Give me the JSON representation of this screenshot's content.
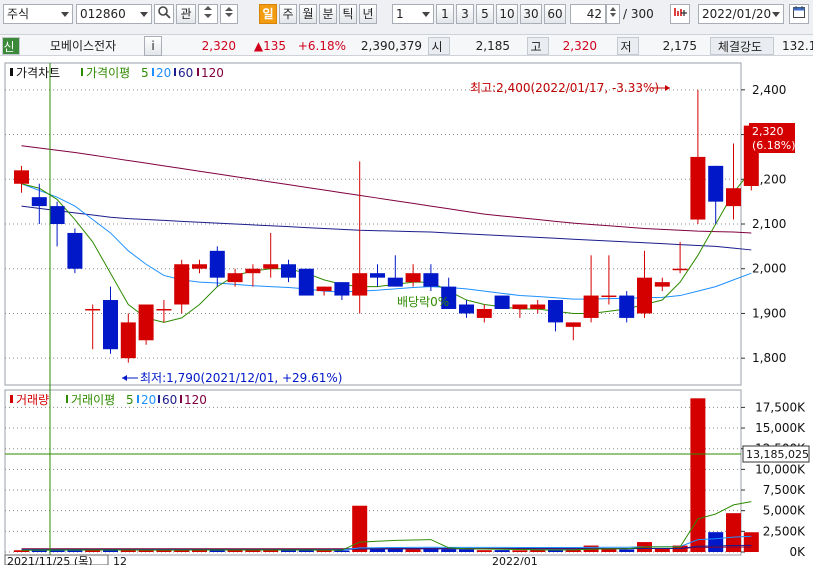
{
  "toolbar": {
    "market_type": "주식",
    "stock_code": "012860",
    "btn_kwan": "관",
    "periods": [
      "일",
      "주",
      "월",
      "분",
      "틱",
      "년"
    ],
    "active_period": "일",
    "minute_select": "1",
    "minute_presets": [
      "1",
      "3",
      "5",
      "10",
      "30",
      "60"
    ],
    "count_value": "42",
    "count_total": "/ 300",
    "date": "2022/01/20"
  },
  "quote": {
    "badge": "신",
    "name": "모베이스전자",
    "info_btn": "i",
    "price": "2,320",
    "change": "▲135",
    "change_rate": "+6.18%",
    "volume": "2,390,379",
    "open_label": "시",
    "open": "2,185",
    "high_label": "고",
    "high": "2,320",
    "low_label": "저",
    "low": "2,175",
    "strength_label": "체결강도",
    "strength": "132.1"
  },
  "price_legend": {
    "title": "가격차트",
    "ma_label": "가격이평",
    "ma_periods": [
      "5",
      "20",
      "60",
      "120"
    ]
  },
  "volume_legend": {
    "title": "거래량",
    "ma_label": "거래이평",
    "ma_periods": [
      "5",
      "20",
      "60",
      "120"
    ]
  },
  "annotations": {
    "high": "최고:2,400(2022/01/17, -3.33%)",
    "low": "최저:1,790(2021/12/01, +29.61%)",
    "ex_dividend": "배당락0%",
    "last_price": "2,320",
    "last_rate": "(6.18%)",
    "volume_cursor": "13,185,025",
    "date_cursor": "2021/11/25 (목)",
    "date_12": "12",
    "date_2022": "2022/01"
  },
  "colors": {
    "up": "#d40000",
    "down": "#0018c8",
    "ma5": "#2e8b00",
    "ma20": "#1e90ff",
    "ma60": "#1c1c8c",
    "ma120": "#800040",
    "grid": "#8a8a8a",
    "cursor": "#2e8b00"
  },
  "chart_data": {
    "type": "candlestick",
    "ylim": [
      1740,
      2460
    ],
    "y_ticks": [
      "2,400",
      "2,300",
      "2,200",
      "2,100",
      "2,000",
      "1,900",
      "1,800"
    ],
    "volume_ylim": [
      0,
      19000
    ],
    "volume_ticks": [
      "17,500K",
      "15,000K",
      "12,500K",
      "10,000K",
      "7,500K",
      "5,000K",
      "2,500K",
      "0K"
    ],
    "candles": [
      {
        "o": 2190,
        "h": 2230,
        "l": 2170,
        "c": 2220
      },
      {
        "o": 2160,
        "h": 2190,
        "l": 2100,
        "c": 2140
      },
      {
        "o": 2140,
        "h": 2150,
        "l": 2050,
        "c": 2100
      },
      {
        "o": 2080,
        "h": 2090,
        "l": 1990,
        "c": 2000
      },
      {
        "o": 1910,
        "h": 1920,
        "l": 1820,
        "c": 1910
      },
      {
        "o": 1930,
        "h": 1960,
        "l": 1810,
        "c": 1820
      },
      {
        "o": 1800,
        "h": 1900,
        "l": 1790,
        "c": 1880
      },
      {
        "o": 1840,
        "h": 1920,
        "l": 1830,
        "c": 1920
      },
      {
        "o": 1910,
        "h": 1930,
        "l": 1880,
        "c": 1910
      },
      {
        "o": 1920,
        "h": 2020,
        "l": 1900,
        "c": 2010
      },
      {
        "o": 2000,
        "h": 2020,
        "l": 1990,
        "c": 2010
      },
      {
        "o": 2040,
        "h": 2050,
        "l": 1960,
        "c": 1980
      },
      {
        "o": 1970,
        "h": 2000,
        "l": 1960,
        "c": 1990
      },
      {
        "o": 1990,
        "h": 2010,
        "l": 1960,
        "c": 2000
      },
      {
        "o": 2000,
        "h": 2080,
        "l": 1980,
        "c": 2010
      },
      {
        "o": 2010,
        "h": 2020,
        "l": 1970,
        "c": 1980
      },
      {
        "o": 2000,
        "h": 2000,
        "l": 1940,
        "c": 1940
      },
      {
        "o": 1950,
        "h": 1960,
        "l": 1940,
        "c": 1960
      },
      {
        "o": 1970,
        "h": 1970,
        "l": 1930,
        "c": 1940
      },
      {
        "o": 1940,
        "h": 2240,
        "l": 1900,
        "c": 1990
      },
      {
        "o": 1990,
        "h": 2010,
        "l": 1960,
        "c": 1980
      },
      {
        "o": 1980,
        "h": 2030,
        "l": 1960,
        "c": 1960
      },
      {
        "o": 1970,
        "h": 2010,
        "l": 1960,
        "c": 1990
      },
      {
        "o": 1990,
        "h": 2010,
        "l": 1950,
        "c": 1960
      },
      {
        "o": 1960,
        "h": 1980,
        "l": 1910,
        "c": 1910
      },
      {
        "o": 1920,
        "h": 1930,
        "l": 1890,
        "c": 1900
      },
      {
        "o": 1890,
        "h": 1920,
        "l": 1880,
        "c": 1910
      },
      {
        "o": 1940,
        "h": 1940,
        "l": 1910,
        "c": 1910
      },
      {
        "o": 1910,
        "h": 1920,
        "l": 1890,
        "c": 1920
      },
      {
        "o": 1910,
        "h": 1930,
        "l": 1900,
        "c": 1920
      },
      {
        "o": 1930,
        "h": 1930,
        "l": 1860,
        "c": 1880
      },
      {
        "o": 1870,
        "h": 1880,
        "l": 1840,
        "c": 1880
      },
      {
        "o": 1890,
        "h": 2030,
        "l": 1880,
        "c": 1940
      },
      {
        "o": 1940,
        "h": 2030,
        "l": 1920,
        "c": 1940
      },
      {
        "o": 1940,
        "h": 1950,
        "l": 1880,
        "c": 1890
      },
      {
        "o": 1900,
        "h": 2040,
        "l": 1890,
        "c": 1980
      },
      {
        "o": 1960,
        "h": 1980,
        "l": 1950,
        "c": 1970
      },
      {
        "o": 2000,
        "h": 2060,
        "l": 1990,
        "c": 2000
      },
      {
        "o": 2110,
        "h": 2400,
        "l": 2100,
        "c": 2250
      },
      {
        "o": 2230,
        "h": 2230,
        "l": 2100,
        "c": 2150
      },
      {
        "o": 2140,
        "h": 2280,
        "l": 2110,
        "c": 2180
      },
      {
        "o": 2185,
        "h": 2320,
        "l": 2175,
        "c": 2320
      }
    ],
    "volume": [
      210,
      260,
      230,
      240,
      200,
      260,
      240,
      230,
      220,
      350,
      250,
      240,
      210,
      230,
      320,
      240,
      220,
      180,
      190,
      5600,
      520,
      450,
      350,
      500,
      330,
      300,
      220,
      230,
      210,
      260,
      240,
      320,
      780,
      430,
      300,
      1200,
      380,
      780,
      18600,
      2400,
      4700,
      2390
    ],
    "ma5": [
      2190,
      2180,
      2155,
      2110,
      2060,
      1990,
      1920,
      1890,
      1880,
      1890,
      1920,
      1960,
      1985,
      1995,
      2000,
      2000,
      1990,
      1975,
      1965,
      1960,
      1960,
      1965,
      1970,
      1970,
      1950,
      1930,
      1920,
      1915,
      1910,
      1910,
      1905,
      1900,
      1900,
      1905,
      1910,
      1920,
      1930,
      1970,
      2030,
      2100,
      2170,
      2220
    ],
    "ma20": [
      2190,
      2175,
      2160,
      2140,
      2110,
      2080,
      2040,
      2010,
      1985,
      1975,
      1970,
      1968,
      1965,
      1962,
      1960,
      1958,
      1955,
      1950,
      1948,
      1950,
      1952,
      1955,
      1958,
      1960,
      1958,
      1955,
      1950,
      1945,
      1940,
      1938,
      1935,
      1932,
      1932,
      1933,
      1934,
      1935,
      1936,
      1940,
      1950,
      1960,
      1975,
      1990
    ],
    "ma60": [
      2140,
      2135,
      2130,
      2125,
      2120,
      2115,
      2112,
      2110,
      2108,
      2106,
      2104,
      2102,
      2100,
      2098,
      2096,
      2094,
      2092,
      2090,
      2088,
      2086,
      2085,
      2084,
      2083,
      2082,
      2080,
      2078,
      2076,
      2074,
      2072,
      2070,
      2068,
      2066,
      2064,
      2062,
      2060,
      2058,
      2056,
      2054,
      2052,
      2050,
      2046,
      2042
    ],
    "ma120": [
      2275,
      2270,
      2265,
      2260,
      2254,
      2248,
      2242,
      2236,
      2230,
      2224,
      2218,
      2212,
      2206,
      2200,
      2194,
      2188,
      2182,
      2176,
      2170,
      2164,
      2158,
      2152,
      2146,
      2140,
      2134,
      2128,
      2122,
      2118,
      2114,
      2110,
      2106,
      2102,
      2099,
      2096,
      2093,
      2090,
      2088,
      2086,
      2084,
      2083,
      2082,
      2080
    ],
    "vma5": [
      210,
      230,
      240,
      245,
      240,
      240,
      235,
      230,
      225,
      230,
      240,
      245,
      240,
      240,
      240,
      240,
      240,
      230,
      220,
      1200,
      1300,
      1400,
      1450,
      1500,
      500,
      400,
      360,
      330,
      300,
      250,
      240,
      250,
      350,
      380,
      400,
      600,
      620,
      620,
      4000,
      4600,
      5700,
      6100
    ],
    "vma20": [
      230,
      232,
      233,
      234,
      235,
      236,
      237,
      236,
      235,
      236,
      237,
      238,
      238,
      238,
      238,
      238,
      238,
      237,
      236,
      500,
      520,
      540,
      560,
      570,
      560,
      560,
      560,
      555,
      550,
      545,
      540,
      540,
      560,
      570,
      580,
      620,
      630,
      650,
      1500,
      1600,
      1800,
      1900
    ],
    "vma60": [
      300,
      300,
      300,
      300,
      300,
      300,
      300,
      300,
      300,
      300,
      300,
      300,
      300,
      300,
      300,
      300,
      300,
      300,
      300,
      360,
      365,
      370,
      375,
      380,
      380,
      380,
      380,
      380,
      380,
      380,
      380,
      380,
      390,
      395,
      400,
      420,
      425,
      430,
      700,
      720,
      780,
      800
    ],
    "vma120": [
      400,
      400,
      400,
      400,
      400,
      400,
      400,
      400,
      400,
      400,
      400,
      400,
      400,
      400,
      400,
      400,
      400,
      400,
      400,
      420,
      420,
      420,
      420,
      420,
      420,
      420,
      420,
      420,
      420,
      420,
      420,
      420,
      425,
      425,
      425,
      430,
      430,
      430,
      560,
      570,
      600,
      610
    ]
  }
}
